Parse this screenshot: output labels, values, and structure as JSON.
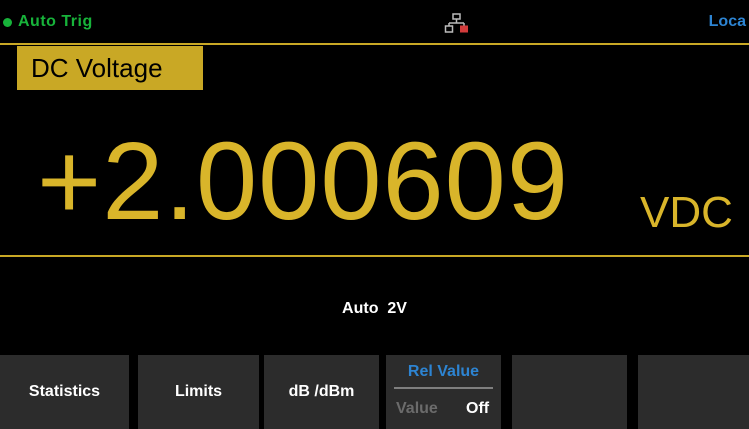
{
  "status": {
    "trigger_mode": "Auto Trig",
    "remote_state": "Loca",
    "trigger_color": "#17b33a",
    "remote_color": "#2d84d2",
    "lan_icon": "lan-network-icon"
  },
  "measurement": {
    "function": "DC Voltage",
    "reading": "+2.000609",
    "unit": "VDC",
    "range": "Auto  2V",
    "accent_color": "#c9a825"
  },
  "softkeys": [
    {
      "label": "Statistics"
    },
    {
      "label": "Limits"
    },
    {
      "label": "dB /dBm"
    },
    {
      "label": "Rel Value",
      "options": [
        "Value",
        "Off"
      ]
    },
    {
      "label": ""
    },
    {
      "label": ""
    }
  ]
}
